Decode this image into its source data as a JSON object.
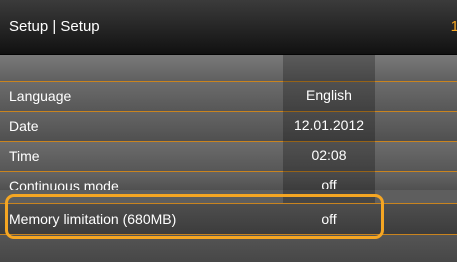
{
  "header": {
    "title": "Setup | Setup",
    "page_indicator": "1"
  },
  "rows": [
    {
      "label": "Language",
      "value": "English"
    },
    {
      "label": "Date",
      "value": "12.01.2012"
    },
    {
      "label": "Time",
      "value": "02:08"
    },
    {
      "label": "Continuous mode",
      "value": "off"
    },
    {
      "label": "Memory limitation (680MB)",
      "value": "off"
    }
  ],
  "colors": {
    "accent": "#f5a623",
    "background": "#5e5e5e"
  }
}
